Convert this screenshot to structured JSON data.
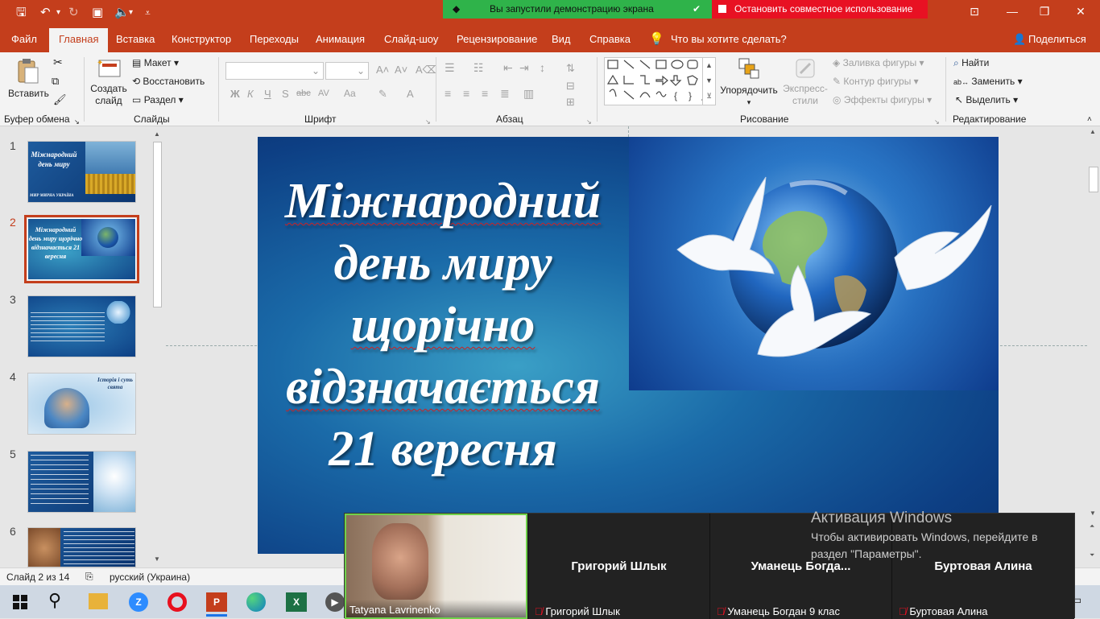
{
  "titlebar": {
    "share_banner": "Вы запустили демонстрацию экрана",
    "stop_share": "Остановить совместное использование",
    "partial_text": "од"
  },
  "menu_tabs": [
    "Файл",
    "Главная",
    "Вставка",
    "Конструктор",
    "Переходы",
    "Анимация",
    "Слайд-шоу",
    "Рецензирование",
    "Вид",
    "Справка"
  ],
  "tell_me": "Что вы хотите сделать?",
  "share_button": "Поделиться",
  "ribbon": {
    "clipboard": {
      "paste": "Вставить",
      "label": "Буфер обмена"
    },
    "slides": {
      "new_slide_1": "Создать",
      "new_slide_2": "слайд",
      "layout": "Макет",
      "reset": "Восстановить",
      "section": "Раздел",
      "label": "Слайды"
    },
    "font": {
      "bold": "Ж",
      "italic": "К",
      "underline": "Ч",
      "strike": "S",
      "spacing": "AV",
      "case": "Aa",
      "label": "Шрифт"
    },
    "paragraph": {
      "label": "Абзац"
    },
    "drawing": {
      "arrange": "Упорядочить",
      "quick_styles_1": "Экспресс-",
      "quick_styles_2": "стили",
      "fill": "Заливка фигуры",
      "outline": "Контур фигуры",
      "effects": "Эффекты фигуры",
      "label": "Рисование"
    },
    "editing": {
      "find": "Найти",
      "replace": "Заменить",
      "select": "Выделить",
      "label": "Редактирование"
    }
  },
  "thumbnails": [
    {
      "num": "1",
      "title": "Міжнародний день миру",
      "caption": "МИР МИРНА УКРАЇНА"
    },
    {
      "num": "2",
      "title": "Міжнародний день миру щорічно відзначається 21 вересня"
    },
    {
      "num": "3",
      "text": "День обрано під ...",
      "inner": ""
    },
    {
      "num": "4",
      "caption": "Історія і суть свята"
    },
    {
      "num": "5",
      "text": "Мир – основа ..."
    },
    {
      "num": "6",
      "text": "День миру був ..."
    }
  ],
  "slide": {
    "title_lines": [
      "Міжнародний",
      "день миру",
      "щорічно",
      "відзначається",
      "21 вересня"
    ]
  },
  "statusbar": {
    "slide_counter": "Слайд 2 из 14",
    "language": "русский (Украина)"
  },
  "video": {
    "self_name": "Tatyana Lavrinenko",
    "participants": [
      {
        "name": "Григорий Шлык",
        "label": "Григорий Шлык"
      },
      {
        "name": "Уманець  Богда...",
        "label": "Уманець Богдан 9 клас"
      },
      {
        "name": "Буртовая Алина",
        "label": "Буртовая Алина"
      }
    ]
  },
  "activation": {
    "title": "Активация Windows",
    "line1": "Чтобы активировать Windows, перейдите в",
    "line2": "раздел \"Параметры\"."
  },
  "colors": {
    "accent": "#c43e1c",
    "share_green": "#2fb34a",
    "stop_red": "#e81123"
  }
}
